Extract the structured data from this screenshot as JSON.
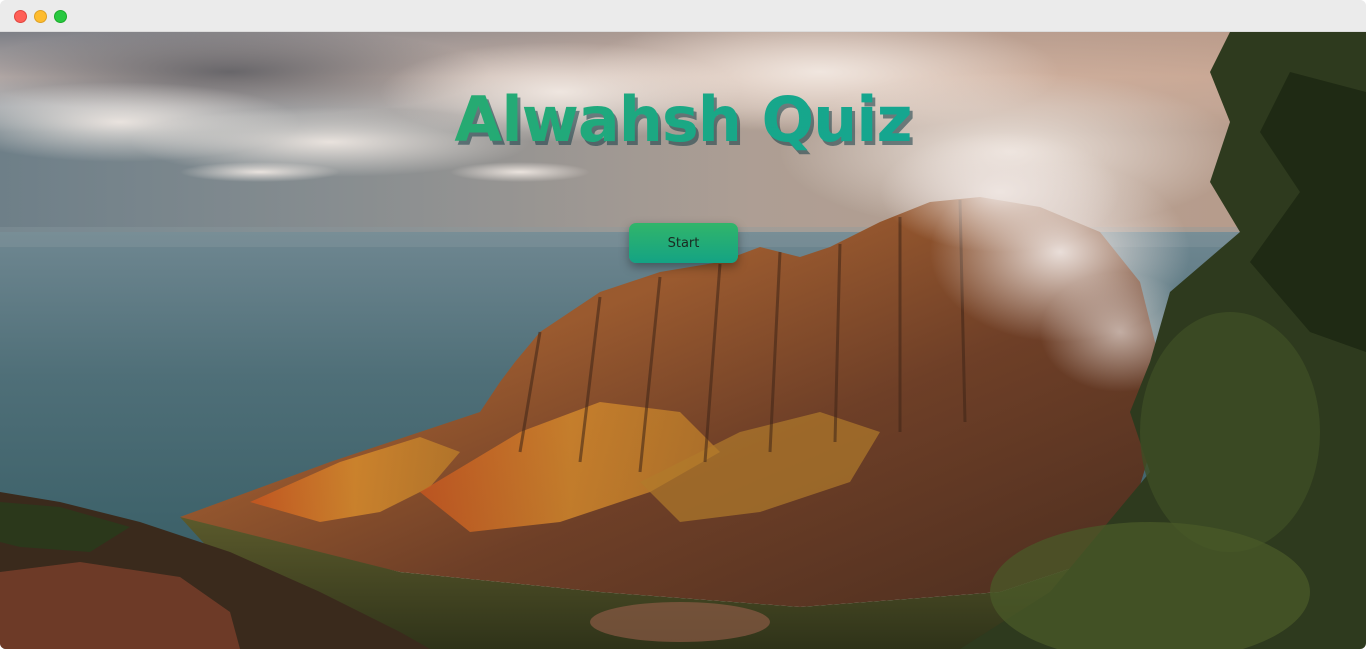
{
  "app": {
    "title": "Alwahsh Quiz",
    "start_label": "Start"
  },
  "window": {
    "controls": [
      "close-icon",
      "minimize-icon",
      "maximize-icon"
    ]
  },
  "colors": {
    "title_gradient_start": "#3fb04a",
    "title_gradient_end": "#0ea3a0",
    "button_top": "#31b56a",
    "button_bottom": "#14a384",
    "close": "#ff5f57",
    "minimize": "#febc2e",
    "maximize": "#28c840"
  }
}
